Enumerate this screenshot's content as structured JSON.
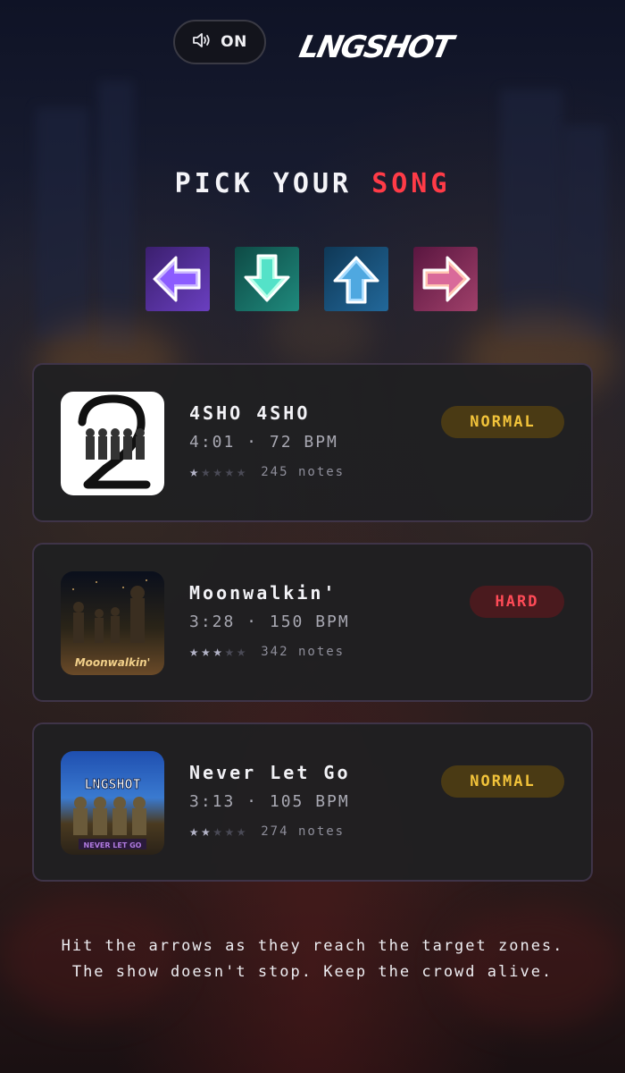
{
  "header": {
    "sound": {
      "icon": "speaker-icon",
      "label": "ON"
    },
    "logo_text": "LNGSHOT"
  },
  "title": {
    "part1": "PICK YOUR",
    "part2": "SONG",
    "accent_color": "#ff3b47"
  },
  "arrows": [
    {
      "icon": "arrow-left-icon",
      "color": "#8c5cff"
    },
    {
      "icon": "arrow-down-icon",
      "color": "#54e2c8"
    },
    {
      "icon": "arrow-up-icon",
      "color": "#4fa8e0"
    },
    {
      "icon": "arrow-right-icon",
      "color": "#d96a9a"
    }
  ],
  "songs": [
    {
      "name": "4SHO 4SHO",
      "meta": "4:01 · 72 BPM",
      "difficulty": "NORMAL",
      "stars": 1,
      "max_stars": 5,
      "notes": "245 notes"
    },
    {
      "name": "Moonwalkin'",
      "meta": "3:28 · 150 BPM",
      "difficulty": "HARD",
      "stars": 3,
      "max_stars": 5,
      "notes": "342 notes",
      "cover_text": "Moonwalkin'"
    },
    {
      "name": "Never Let Go",
      "meta": "3:13 · 105 BPM",
      "difficulty": "NORMAL",
      "stars": 2,
      "max_stars": 5,
      "notes": "274 notes",
      "cover_text": "LNGSHOT",
      "cover_subtext": "NEVER LET GO"
    }
  ],
  "footer": {
    "line1": "Hit the arrows as they reach the target zones.",
    "line2": "The show doesn't stop. Keep the crowd alive."
  },
  "colors": {
    "normal_badge": "#f2c33a",
    "hard_badge": "#ff4b57",
    "card_border": "#3f3448"
  }
}
